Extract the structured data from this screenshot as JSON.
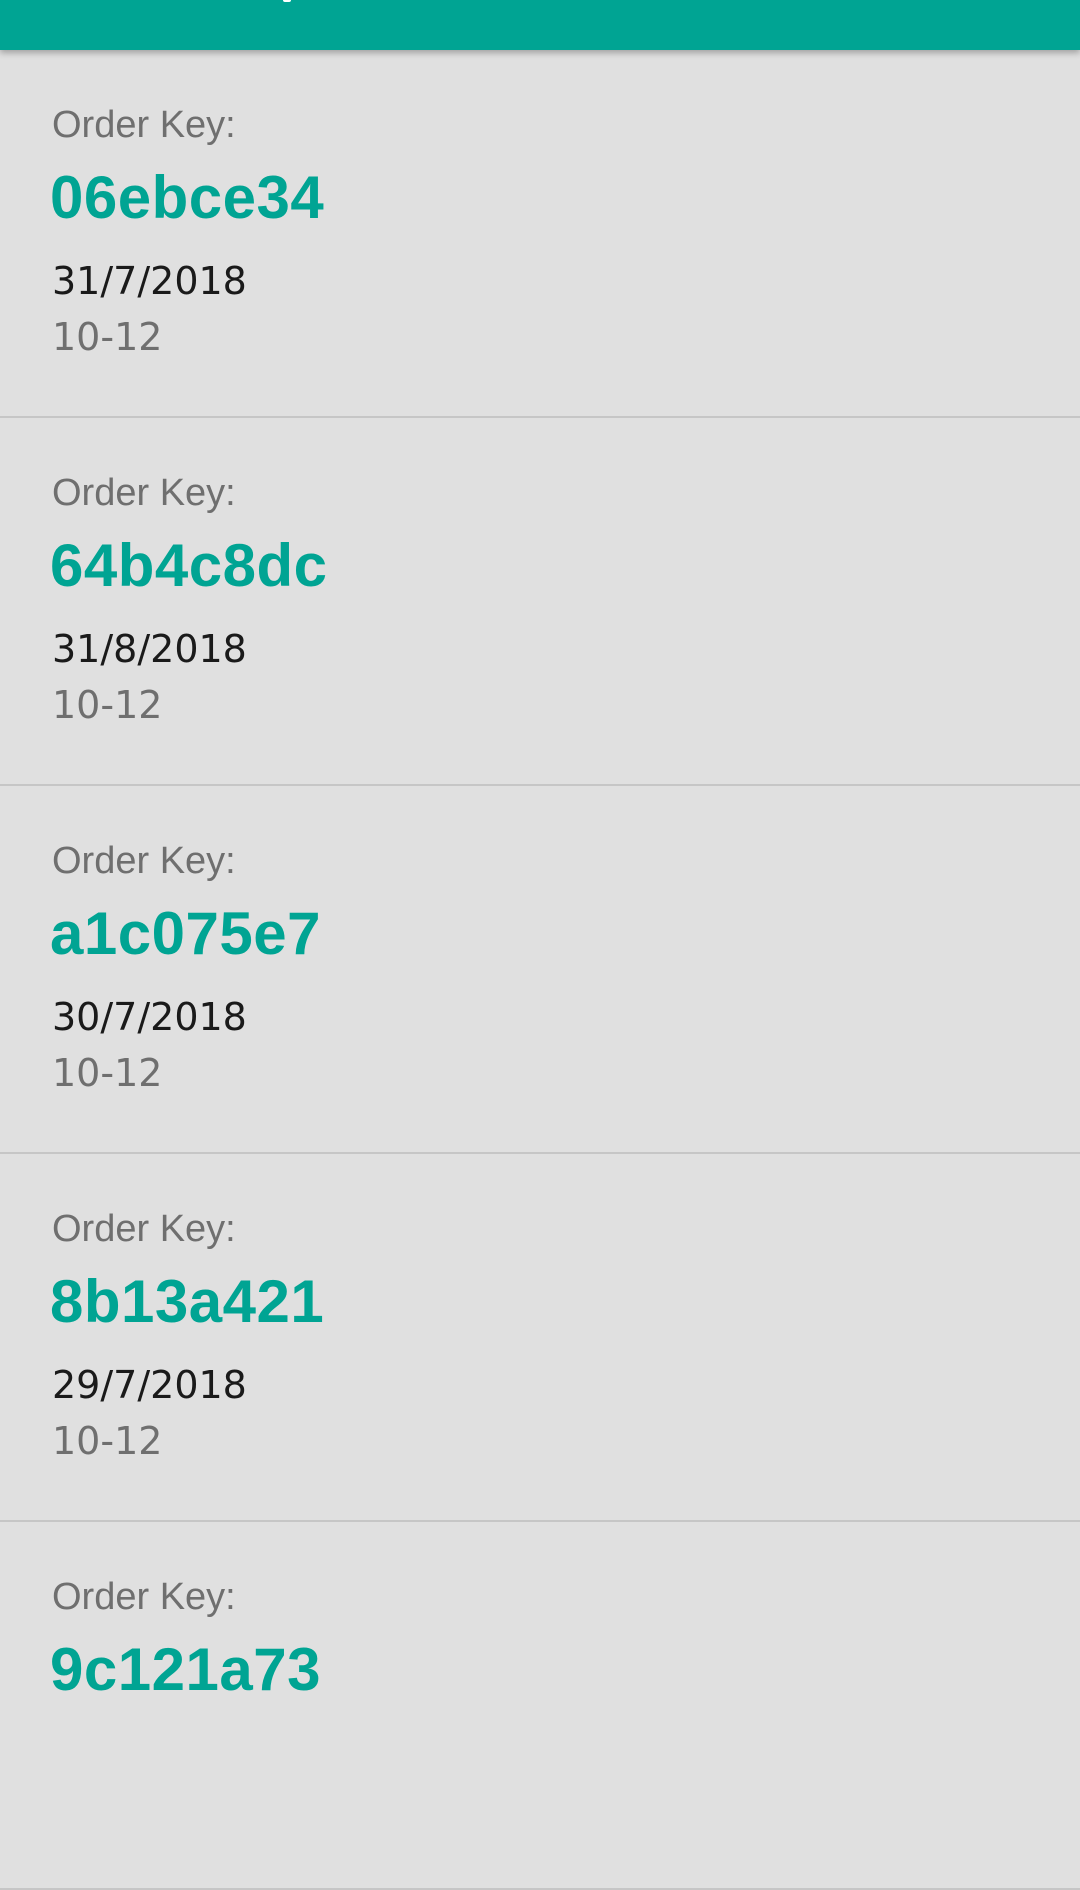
{
  "theme": {
    "primary": "#00a493",
    "background": "#e0e0e0",
    "divider": "#c6c6c6",
    "label_color": "#6f6f6f",
    "date_color": "#1a1a1a"
  },
  "orders": [
    {
      "label": "Order Key:",
      "key": "06ebce34",
      "date": "31/7/2018",
      "slot": "10-12"
    },
    {
      "label": "Order Key:",
      "key": "64b4c8dc",
      "date": "31/8/2018",
      "slot": "10-12"
    },
    {
      "label": "Order Key:",
      "key": "a1c075e7",
      "date": "30/7/2018",
      "slot": "10-12"
    },
    {
      "label": "Order Key:",
      "key": "8b13a421",
      "date": "29/7/2018",
      "slot": "10-12"
    },
    {
      "label": "Order Key:",
      "key": "9c121a73"
    }
  ]
}
